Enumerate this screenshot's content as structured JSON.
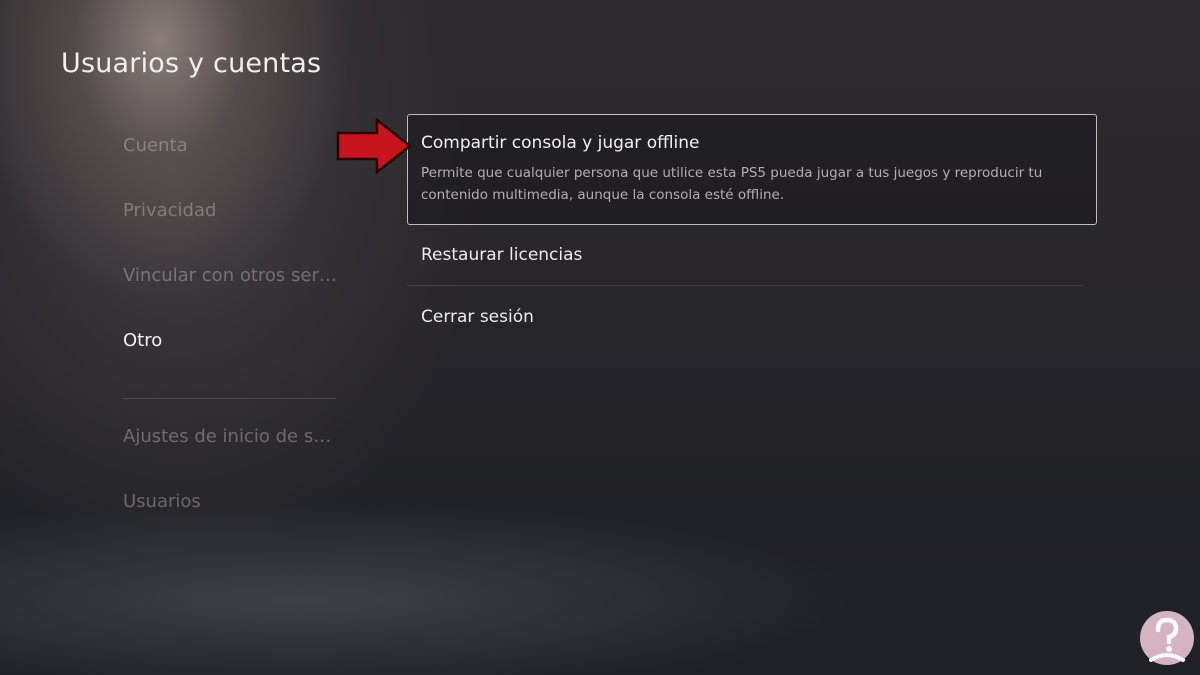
{
  "header": {
    "title": "Usuarios y cuentas"
  },
  "sidebar": {
    "items": [
      {
        "label": "Cuenta",
        "active": false
      },
      {
        "label": "Privacidad",
        "active": false
      },
      {
        "label": "Vincular con otros servi...",
        "active": false
      },
      {
        "label": "Otro",
        "active": true
      },
      {
        "label": "Ajustes de inicio de ses...",
        "active": false
      },
      {
        "label": "Usuarios",
        "active": false
      }
    ]
  },
  "main": {
    "items": [
      {
        "title": "Compartir consola y jugar offline",
        "description": "Permite que cualquier persona que utilice esta PS5 pueda jugar a tus juegos y reproducir tu contenido multimedia, aunque la consola esté offline.",
        "focused": true
      },
      {
        "title": "Restaurar licencias",
        "focused": false
      },
      {
        "title": "Cerrar sesión",
        "focused": false
      }
    ]
  },
  "annotation": {
    "icon": "red-arrow-pointer-icon",
    "color": "#c8141c"
  },
  "watermark": {
    "icon": "person-with-question-mark-logo-icon",
    "color": "#e8c4d2"
  }
}
